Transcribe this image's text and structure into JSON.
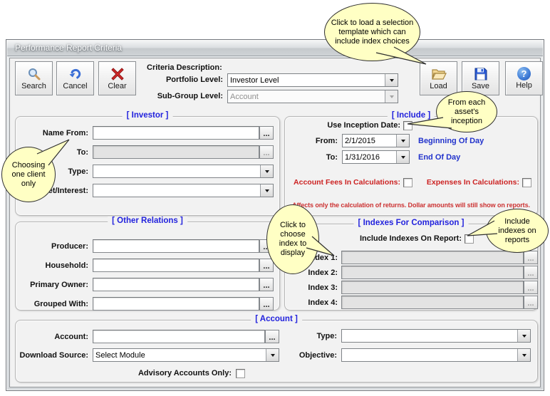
{
  "window": {
    "title": "Performance Report Criteria"
  },
  "toolbar": {
    "search": "Search",
    "cancel": "Cancel",
    "clear": "Clear",
    "load": "Load",
    "save": "Save",
    "help": "Help",
    "criteria_description_label": "Criteria Description:",
    "portfolio_level_label": "Portfolio Level:",
    "portfolio_level_value": "Investor Level",
    "subgroup_level_label": "Sub-Group Level:",
    "subgroup_level_value": "Account"
  },
  "investor": {
    "title": "[ Investor ]",
    "name_from_label": "Name From:",
    "to_label": "To:",
    "type_label": "Type:",
    "market_label": "Market/Interest:"
  },
  "include": {
    "title": "[ Include ]",
    "use_inception_label": "Use Inception Date:",
    "from_label": "From:",
    "from_value": "2/1/2015",
    "from_note": "Beginning Of Day",
    "to_label": "To:",
    "to_value": "1/31/2016",
    "to_note": "End Of Day",
    "fees_label": "Account Fees In Calculations:",
    "expenses_label": "Expenses In Calculations:",
    "note": "Affects only the calculation of returns. Dollar amounts will still show on reports."
  },
  "other_relations": {
    "title": "[ Other Relations ]",
    "producer_label": "Producer:",
    "household_label": "Household:",
    "primary_owner_label": "Primary Owner:",
    "grouped_with_label": "Grouped With:"
  },
  "indexes": {
    "title": "[ Indexes For Comparison ]",
    "include_label": "Include Indexes On Report:",
    "index1_label": "Index 1:",
    "index2_label": "Index 2:",
    "index3_label": "Index 3:",
    "index4_label": "Index 4:"
  },
  "account": {
    "title": "[ Account ]",
    "account_label": "Account:",
    "download_source_label": "Download Source:",
    "download_source_value": "Select Module",
    "type_label": "Type:",
    "objective_label": "Objective:",
    "advisory_label": "Advisory Accounts Only:"
  },
  "callouts": {
    "load_template": "Click to load a selection template which can include index choices",
    "inception": "From each asset's inception",
    "one_client": "Choosing one client only",
    "choose_index": "Click to choose index to display",
    "include_indexes": "Include indexes on reports"
  },
  "ui": {
    "ellipsis": "...",
    "help_glyph": "?"
  },
  "colors": {
    "section_title": "#2222dd",
    "warning": "#cc2222",
    "day_note": "#2233cc",
    "callout_bg": "#ffffc4"
  }
}
